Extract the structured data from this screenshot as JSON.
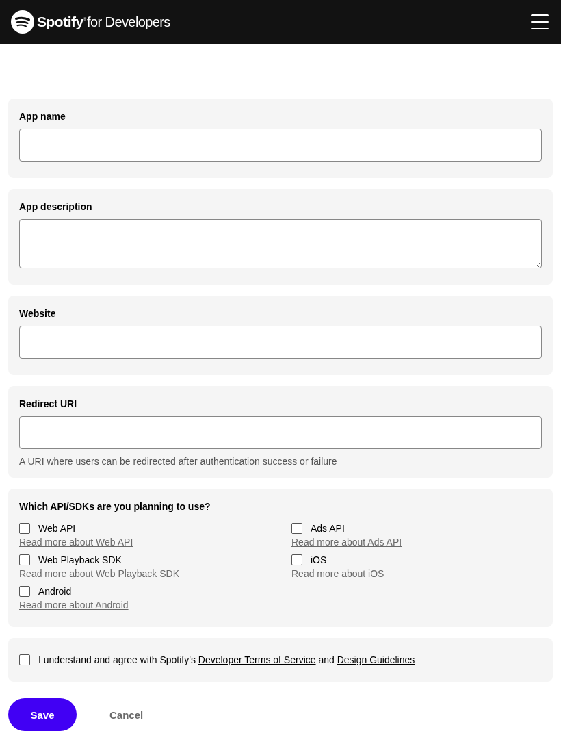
{
  "header": {
    "brand": "Spotify",
    "brand_mark": "®",
    "brand_suffix": "for Developers"
  },
  "fields": [
    {
      "label": "App name",
      "kind": "input"
    },
    {
      "label": "App description",
      "kind": "textarea"
    },
    {
      "label": "Website",
      "kind": "input"
    },
    {
      "label": "Redirect URI",
      "kind": "input",
      "help": "A URI where users can be redirected after authentication success or failure"
    }
  ],
  "apis": {
    "question": "Which API/SDKs are you planning to use?",
    "options": [
      {
        "label": "Web API",
        "checked": false,
        "link": "Read more about Web API"
      },
      {
        "label": "Ads API",
        "checked": false,
        "link": "Read more about Ads API"
      },
      {
        "label": "Web Playback SDK",
        "checked": false,
        "link": "Read more about Web Playback SDK"
      },
      {
        "label": "iOS",
        "checked": false,
        "link": "Read more about iOS"
      },
      {
        "label": "Android",
        "checked": false,
        "link": "Read more about Android"
      }
    ]
  },
  "agreement": {
    "checked": false,
    "before": "I understand and agree with Spotify's",
    "terms_link": "Developer Terms of Service",
    "middle": "and",
    "guidelines_link": "Design Guidelines"
  },
  "buttons": {
    "save": "Save",
    "cancel": "Cancel"
  }
}
